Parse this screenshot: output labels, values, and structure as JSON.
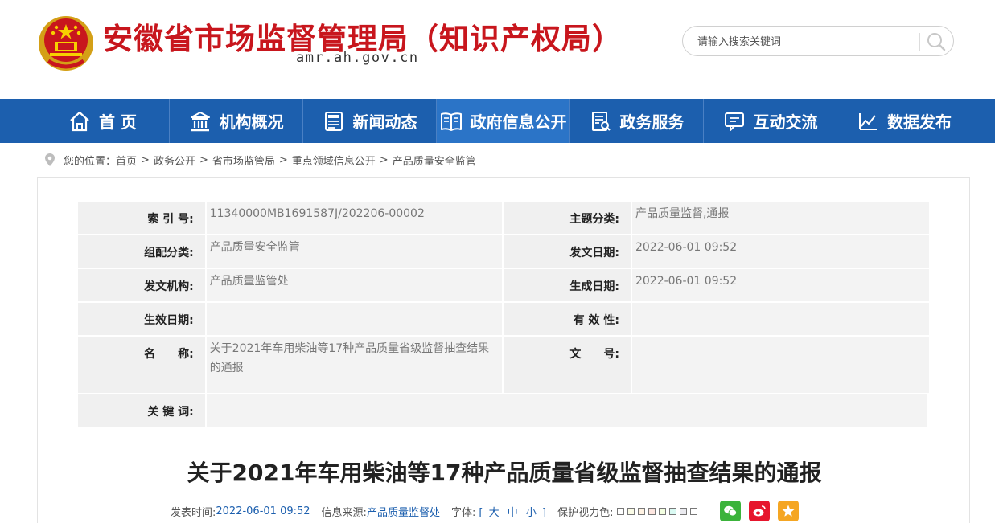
{
  "header": {
    "site_title": "安徽省市场监督管理局（知识产权局）",
    "domain": "amr.ah.gov.cn",
    "emblem_icon": "national-emblem-icon"
  },
  "search": {
    "placeholder": "请输入搜索关键词",
    "icon": "search-icon"
  },
  "nav": {
    "items": [
      {
        "label": "首 页",
        "icon": "home-icon"
      },
      {
        "label": "机构概况",
        "icon": "institution-icon"
      },
      {
        "label": "新闻动态",
        "icon": "news-icon"
      },
      {
        "label": "政府信息公开",
        "icon": "open-book-icon",
        "active": true
      },
      {
        "label": "政务服务",
        "icon": "service-icon"
      },
      {
        "label": "互动交流",
        "icon": "chat-icon"
      },
      {
        "label": "数据发布",
        "icon": "chart-line-icon"
      }
    ],
    "active_color": "#2b74c7",
    "bar_color": "#1c5fae"
  },
  "breadcrumb": {
    "prefix": "您的位置：",
    "items": [
      "首页",
      "政务公开",
      "省市场监管局",
      "重点领域信息公开",
      "产品质量安全监管"
    ],
    "separator": ">"
  },
  "meta": {
    "index_label": "索 引 号:",
    "index_value": "11340000MB1691587J/202206-00002",
    "topic_label": "主题分类:",
    "topic_value": "产品质量监督,通报",
    "org_cat_label": "组配分类:",
    "org_cat_value": "产品质量安全监管",
    "issue_date_label": "发文日期:",
    "issue_date_value": "2022-06-01 09:52",
    "issuer_label": "发文机构:",
    "issuer_value": "产品质量监管处",
    "gen_date_label": "生成日期:",
    "gen_date_value": "2022-06-01 09:52",
    "effective_label": "生效日期:",
    "effective_value": "",
    "validity_label": "有 效 性:",
    "validity_value": "",
    "name_label": "名　　称:",
    "name_value": "关于2021年车用柴油等17种产品质量省级监督抽查结果的通报",
    "docno_label": "文　　号:",
    "docno_value": "",
    "keywords_label": "关 键 词:",
    "keywords_value": ""
  },
  "article": {
    "title": "关于2021年车用柴油等17种产品质量省级监督抽查结果的通报",
    "publish_label": "发表时间:",
    "publish_value": "2022-06-01 09:52",
    "source_label": "信息来源:",
    "source_value": "产品质量监督处",
    "font_label": "字体:",
    "font_open": "[",
    "font_large": "大",
    "font_medium": "中",
    "font_small": "小",
    "font_close": "]",
    "eye_label": "保护视力色:",
    "eye_colors": [
      "#ffffff",
      "#fafbe6",
      "#fff2e2",
      "#fde6e0",
      "#f3ffe1",
      "#dafaf3",
      "#eaeaef",
      "#ffffff"
    ],
    "share_wechat_color": "#3bb33b",
    "share_weibo_color": "#e6162d",
    "share_qzone_color": "#f5a623"
  }
}
